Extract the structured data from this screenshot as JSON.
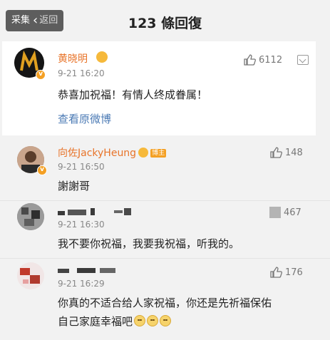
{
  "header": {
    "back_label": "采集",
    "back_suffix": "返回",
    "title": "123 條回復"
  },
  "main_comment": {
    "author": "黄晓明",
    "time": "9-21 16:20",
    "text": "恭喜加祝福！有情人终成眷属！",
    "link": "查看原微博",
    "likes": "6112"
  },
  "replies": [
    {
      "author": "向佐JackyHeung",
      "badge": "博主",
      "time": "9-21 16:50",
      "text": "謝謝哥",
      "likes": "148"
    },
    {
      "author": "",
      "time": "9-21 16:30",
      "text": "我不要你祝福，我要我祝福，听我的。",
      "likes": "467"
    },
    {
      "author": "",
      "time": "9-21 16:29",
      "text_line1": "你真的不适合给人家祝福，你还是先祈福保佑",
      "text_line2": "自己家庭幸福吧",
      "likes": "176"
    }
  ]
}
